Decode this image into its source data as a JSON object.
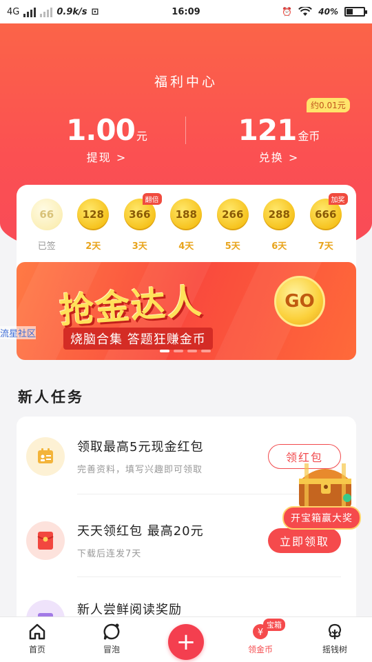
{
  "status_bar": {
    "network": "4G",
    "speed": "0.9k/s",
    "time": "16:09",
    "battery": "40%"
  },
  "header": {
    "title": "福利中心",
    "cash": {
      "amount": "1.00",
      "unit": "元",
      "action": "提现 >"
    },
    "coins": {
      "amount": "121",
      "unit": "金币",
      "action": "兑换 >",
      "rate_tag": "约0.01元"
    }
  },
  "checkin": {
    "days": [
      {
        "coins": "66",
        "label": "已签",
        "signed": true,
        "badge": ""
      },
      {
        "coins": "128",
        "label": "2天",
        "signed": false,
        "badge": ""
      },
      {
        "coins": "366",
        "label": "3天",
        "signed": false,
        "badge": "翻倍"
      },
      {
        "coins": "188",
        "label": "4天",
        "signed": false,
        "badge": ""
      },
      {
        "coins": "266",
        "label": "5天",
        "signed": false,
        "badge": ""
      },
      {
        "coins": "288",
        "label": "6天",
        "signed": false,
        "badge": ""
      },
      {
        "coins": "666",
        "label": "7天",
        "signed": false,
        "badge": "加奖"
      }
    ]
  },
  "banner": {
    "title": "抢金达人",
    "subtitle": "烧脑合集 答题狂赚金币",
    "go_label": "GO"
  },
  "watermark": "流星社区",
  "tasks": {
    "section_title": "新人任务",
    "items": [
      {
        "title": "领取最高5元现金红包",
        "desc": "完善资料，填写兴趣即可领取",
        "button": "领红包",
        "icon": "calendar-card-icon"
      },
      {
        "title": "天天领红包 最高20元",
        "desc": "下载后连发7天",
        "button": "立即领取",
        "icon": "red-envelope-icon"
      },
      {
        "title": "新人尝鲜阅读奖励",
        "desc": "",
        "button": "",
        "icon": "book-icon"
      }
    ]
  },
  "treasure": {
    "label": "开宝箱赢大奖"
  },
  "bottom_nav": {
    "items": [
      {
        "label": "首页",
        "icon": "home-icon"
      },
      {
        "label": "冒泡",
        "icon": "bubble-icon"
      },
      {
        "label": "",
        "icon": "plus-icon"
      },
      {
        "label": "领金币",
        "icon": "coin-icon",
        "badge": "宝箱"
      },
      {
        "label": "摇钱树",
        "icon": "money-tree-icon"
      }
    ]
  },
  "colors": {
    "accent": "#f54a4c",
    "gold": "#f6c21c",
    "hero_top": "#fb6448"
  }
}
